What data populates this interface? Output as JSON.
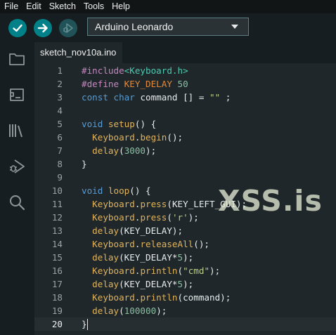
{
  "menu": [
    "File",
    "Edit",
    "Sketch",
    "Tools",
    "Help"
  ],
  "toolbar": {
    "verify_icon": "check-icon",
    "upload_icon": "arrow-right-icon",
    "debug_icon": "debug-icon",
    "board": "Arduino Leonardo"
  },
  "sidebar_icons": [
    "folder-icon",
    "board-icon",
    "library-icon",
    "debug-icon",
    "search-icon"
  ],
  "tab": {
    "label": "sketch_nov10a.ino"
  },
  "watermark": "XSS.is",
  "colors": {
    "accent": "#00818a",
    "background": "#1f272a",
    "keyword": "#569cd6",
    "function": "#e2b35a",
    "string": "#b9cf8a",
    "number": "#8bbfa3",
    "preprocessor": "#c586c0"
  },
  "editor": {
    "active_line": 20,
    "lines": [
      [
        [
          "pp",
          "#include"
        ],
        [
          "lib",
          "<Keyboard.h>"
        ]
      ],
      [
        [
          "pp",
          "#define"
        ],
        [
          "pl",
          " "
        ],
        [
          "cst",
          "KEY_DELAY"
        ],
        [
          "pl",
          " "
        ],
        [
          "num",
          "50"
        ]
      ],
      [
        [
          "kw",
          "const"
        ],
        [
          "pl",
          " "
        ],
        [
          "kw",
          "char"
        ],
        [
          "pl",
          " command [] = "
        ],
        [
          "str",
          "\"\""
        ],
        [
          "pl",
          " ;"
        ]
      ],
      [],
      [
        [
          "kw",
          "void"
        ],
        [
          "pl",
          " "
        ],
        [
          "fn",
          "setup"
        ],
        [
          "pl",
          "() {"
        ]
      ],
      [
        [
          "pl",
          "  "
        ],
        [
          "fn",
          "Keyboard"
        ],
        [
          "pl",
          "."
        ],
        [
          "fn",
          "begin"
        ],
        [
          "pl",
          "();"
        ]
      ],
      [
        [
          "pl",
          "  "
        ],
        [
          "fn",
          "delay"
        ],
        [
          "pl",
          "("
        ],
        [
          "num",
          "3000"
        ],
        [
          "pl",
          ");"
        ]
      ],
      [
        [
          "pl",
          "}"
        ]
      ],
      [],
      [
        [
          "kw",
          "void"
        ],
        [
          "pl",
          " "
        ],
        [
          "fn",
          "loop"
        ],
        [
          "pl",
          "() {"
        ]
      ],
      [
        [
          "pl",
          "  "
        ],
        [
          "fn",
          "Keyboard"
        ],
        [
          "pl",
          "."
        ],
        [
          "fn",
          "press"
        ],
        [
          "pl",
          "(KEY_LEFT_GUI);"
        ]
      ],
      [
        [
          "pl",
          "  "
        ],
        [
          "fn",
          "Keyboard"
        ],
        [
          "pl",
          "."
        ],
        [
          "fn",
          "press"
        ],
        [
          "pl",
          "("
        ],
        [
          "str",
          "'r'"
        ],
        [
          "pl",
          ");"
        ]
      ],
      [
        [
          "pl",
          "  "
        ],
        [
          "fn",
          "delay"
        ],
        [
          "pl",
          "(KEY_DELAY);"
        ]
      ],
      [
        [
          "pl",
          "  "
        ],
        [
          "fn",
          "Keyboard"
        ],
        [
          "pl",
          "."
        ],
        [
          "fn",
          "releaseAll"
        ],
        [
          "pl",
          "();"
        ]
      ],
      [
        [
          "pl",
          "  "
        ],
        [
          "fn",
          "delay"
        ],
        [
          "pl",
          "(KEY_DELAY*"
        ],
        [
          "num",
          "5"
        ],
        [
          "pl",
          ");"
        ]
      ],
      [
        [
          "pl",
          "  "
        ],
        [
          "fn",
          "Keyboard"
        ],
        [
          "pl",
          "."
        ],
        [
          "fn",
          "println"
        ],
        [
          "pl",
          "("
        ],
        [
          "str",
          "\"cmd\""
        ],
        [
          "pl",
          ");"
        ]
      ],
      [
        [
          "pl",
          "  "
        ],
        [
          "fn",
          "delay"
        ],
        [
          "pl",
          "(KEY_DELAY*"
        ],
        [
          "num",
          "5"
        ],
        [
          "pl",
          ");"
        ]
      ],
      [
        [
          "pl",
          "  "
        ],
        [
          "fn",
          "Keyboard"
        ],
        [
          "pl",
          "."
        ],
        [
          "fn",
          "println"
        ],
        [
          "pl",
          "(command);"
        ]
      ],
      [
        [
          "pl",
          "  "
        ],
        [
          "fn",
          "delay"
        ],
        [
          "pl",
          "("
        ],
        [
          "num",
          "100000"
        ],
        [
          "pl",
          ");"
        ]
      ],
      [
        [
          "pl",
          "}"
        ]
      ]
    ]
  }
}
